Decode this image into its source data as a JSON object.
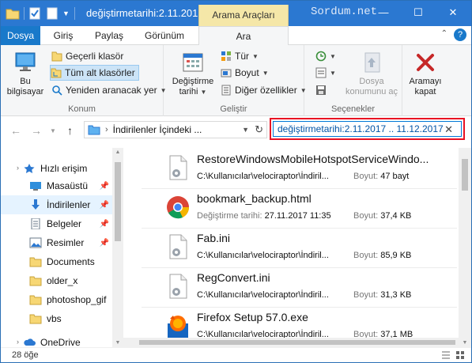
{
  "titlebar": {
    "title": "değiştirmetarihi:2.11.201...",
    "context_tab": "Arama Araçları",
    "watermark": "Sordum.net",
    "buttons": {
      "minimize": "—",
      "maximize": "☐",
      "close": "✕"
    }
  },
  "ribbon_tabs": {
    "file": "Dosya",
    "home": "Giriş",
    "share": "Paylaş",
    "view": "Görünüm",
    "search": "Ara",
    "help": "?"
  },
  "ribbon": {
    "location": {
      "this_pc": "Bu bilgisayar",
      "current_folder": "Geçerli klasör",
      "all_subfolders": "Tüm alt klasörler",
      "search_again": "Yeniden aranacak yer",
      "group_label": "Konum"
    },
    "refine": {
      "date_modified": "Değiştirme tarihi",
      "kind": "Tür",
      "size": "Boyut",
      "other_properties": "Diğer özellikler",
      "group_label": "Geliştir"
    },
    "options": {
      "open_file_location": "Dosya konumunu aç",
      "group_label": "Seçenekler"
    },
    "close_search": "Aramayı kapat"
  },
  "address": {
    "path": "İndirilenler İçindeki ...",
    "search_query": "değiştirmetarihi:2.11.2017 .. 11.12.2017",
    "clear": "✕"
  },
  "nav": {
    "items": [
      {
        "label": "Hızlı erişim"
      },
      {
        "label": "Masaüstü"
      },
      {
        "label": "İndirilenler"
      },
      {
        "label": "Belgeler"
      },
      {
        "label": "Resimler"
      },
      {
        "label": "Documents"
      },
      {
        "label": "older_x"
      },
      {
        "label": "photoshop_gif"
      },
      {
        "label": "vbs"
      },
      {
        "label": "OneDrive"
      }
    ]
  },
  "files": [
    {
      "name": "RestoreWindowsMobileHotspotServiceWindo...",
      "path": "C:\\Kullanıcılar\\velociraptor\\İndiril...",
      "size_label": "Boyut:",
      "size": "47 bayt",
      "icon": "settings-file-icon"
    },
    {
      "name": "bookmark_backup.html",
      "path_label": "Değiştirme tarihi:",
      "path": "27.11.2017 11:35",
      "size_label": "Boyut:",
      "size": "37,4 KB",
      "icon": "chrome-icon"
    },
    {
      "name": "Fab.ini",
      "path": "C:\\Kullanıcılar\\velociraptor\\İndiril...",
      "size_label": "Boyut:",
      "size": "85,9 KB",
      "icon": "settings-file-icon"
    },
    {
      "name": "RegConvert.ini",
      "path": "C:\\Kullanıcılar\\velociraptor\\İndiril...",
      "size_label": "Boyut:",
      "size": "31,3 KB",
      "icon": "settings-file-icon"
    },
    {
      "name": "Firefox Setup 57.0.exe",
      "path": "C:\\Kullanıcılar\\velociraptor\\İndiril...",
      "size_label": "Boyut:",
      "size": "37,1 MB",
      "icon": "firefox-icon"
    }
  ],
  "status": {
    "count": "28 öğe"
  },
  "colors": {
    "titlebar": "#2b78d1",
    "accent": "#1979ca",
    "highlight": "#e81123"
  }
}
